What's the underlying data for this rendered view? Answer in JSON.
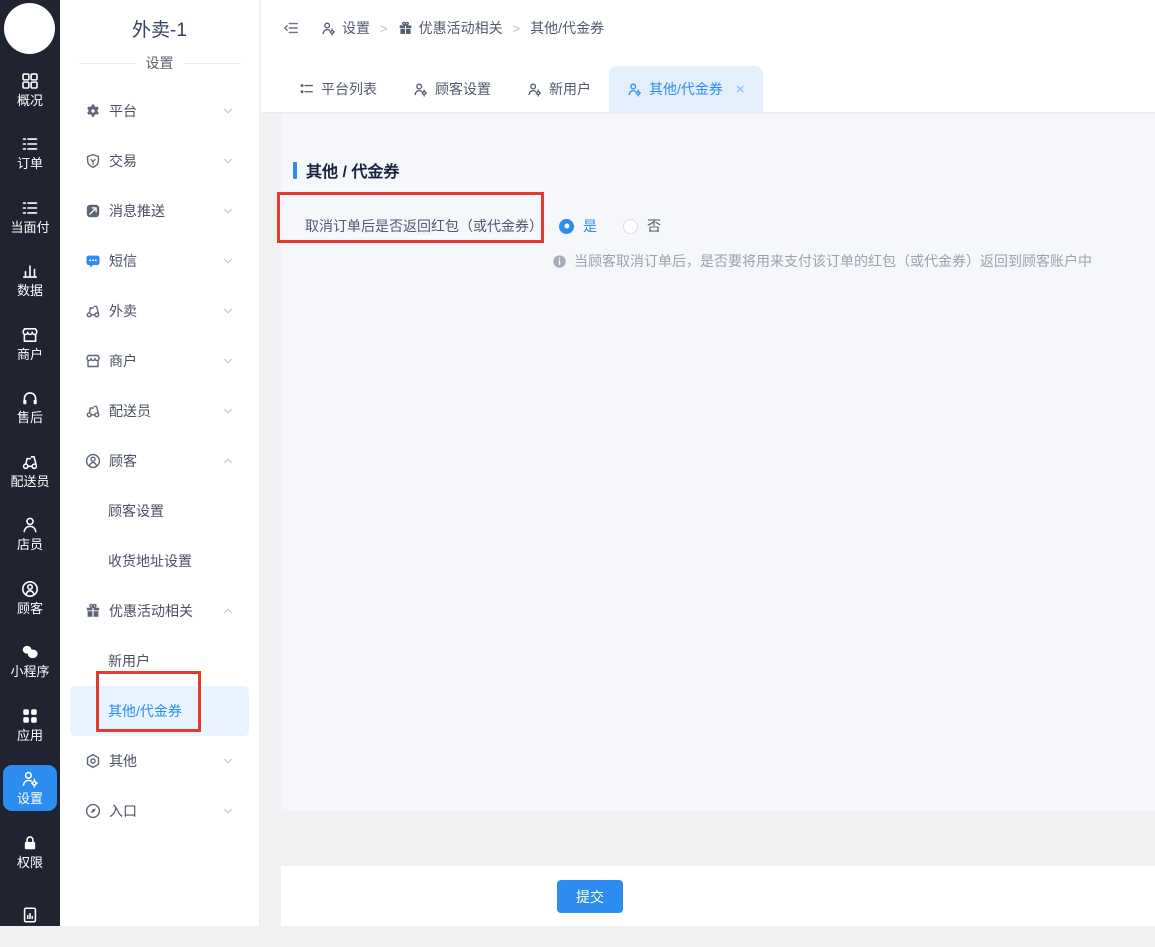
{
  "rail": {
    "items": [
      {
        "label": "概况",
        "icon": "grid"
      },
      {
        "label": "订单",
        "icon": "list"
      },
      {
        "label": "当面付",
        "icon": "list"
      },
      {
        "label": "数据",
        "icon": "bars"
      },
      {
        "label": "商户",
        "icon": "shop"
      },
      {
        "label": "售后",
        "icon": "headset"
      },
      {
        "label": "配送员",
        "icon": "scooter"
      },
      {
        "label": "店员",
        "icon": "person"
      },
      {
        "label": "顾客",
        "icon": "person-circle"
      },
      {
        "label": "小程序",
        "icon": "chat-duo"
      },
      {
        "label": "应用",
        "icon": "four-squares"
      },
      {
        "label": "设置",
        "icon": "person-gear",
        "active": true
      },
      {
        "label": "权限",
        "icon": "lock"
      },
      {
        "label": "",
        "icon": "file-chart"
      }
    ]
  },
  "sidebar": {
    "title": "外卖-1",
    "subtitle": "设置",
    "items": [
      {
        "label": "平台",
        "icon": "gear",
        "chevron": "down"
      },
      {
        "label": "交易",
        "icon": "shield",
        "chevron": "down"
      },
      {
        "label": "消息推送",
        "icon": "push",
        "chevron": "down"
      },
      {
        "label": "短信",
        "icon": "sms",
        "chevron": "down",
        "icon_color": "#2d8cf0"
      },
      {
        "label": "外卖",
        "icon": "scooter",
        "chevron": "down"
      },
      {
        "label": "商户",
        "icon": "shop",
        "chevron": "down"
      },
      {
        "label": "配送员",
        "icon": "scooter",
        "chevron": "down"
      },
      {
        "label": "顾客",
        "icon": "person-circle",
        "chevron": "up"
      },
      {
        "label": "顾客设置",
        "child": true
      },
      {
        "label": "收货地址设置",
        "child": true
      },
      {
        "label": "优惠活动相关",
        "icon": "gift",
        "chevron": "up"
      },
      {
        "label": "新用户",
        "child": true
      },
      {
        "label": "其他/代金券",
        "child": true,
        "active": true
      },
      {
        "label": "其他",
        "icon": "hex",
        "chevron": "down"
      },
      {
        "label": "入口",
        "icon": "compass",
        "chevron": "down"
      }
    ]
  },
  "breadcrumb": {
    "separator": ">",
    "items": [
      {
        "label": "设置",
        "icon": "person-gear"
      },
      {
        "label": "优惠活动相关",
        "icon": "gift"
      },
      {
        "label": "其他/代金券"
      }
    ]
  },
  "tabs": [
    {
      "label": "平台列表",
      "icon": "platform-list"
    },
    {
      "label": "顾客设置",
      "icon": "person-gear"
    },
    {
      "label": "新用户",
      "icon": "person-gear"
    },
    {
      "label": "其他/代金券",
      "icon": "person-gear",
      "active": true,
      "closable": true,
      "close_glyph": "×"
    }
  ],
  "content": {
    "heading": "其他 / 代金券",
    "form": {
      "label": "取消订单后是否返回红包（或代金券）",
      "options": [
        {
          "label": "是",
          "selected": true
        },
        {
          "label": "否",
          "selected": false
        }
      ],
      "hint": "当顾客取消订单后，是否要将用来支付该订单的红包（或代金券）返回到顾客账户中"
    },
    "submit_label": "提交"
  },
  "colors": {
    "accent": "#2d8cf0",
    "rail_bg": "#1f2430",
    "active_item_bg": "#e8f4ff",
    "active_tab_bg": "#e4effc",
    "panel_bg": "#f5f7fb",
    "annotation": "#e53a2e"
  }
}
